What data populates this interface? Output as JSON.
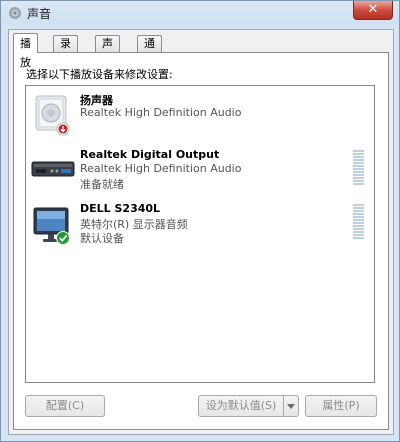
{
  "window": {
    "title": "声音",
    "close_glyph": "✕"
  },
  "tabs": [
    {
      "label": "播放",
      "active": true
    },
    {
      "label": "录制",
      "active": false
    },
    {
      "label": "声音",
      "active": false
    },
    {
      "label": "通信",
      "active": false
    }
  ],
  "panel": {
    "instruction": "选择以下播放设备来修改设置:",
    "devices": [
      {
        "name": "扬声器",
        "description": "Realtek High Definition Audio",
        "status": "",
        "icon": "speaker-icon",
        "badge": "red-down-arrow"
      },
      {
        "name": "Realtek Digital Output",
        "description": "Realtek High Definition Audio",
        "status": "准备就绪",
        "icon": "digital-output-icon",
        "badge": ""
      },
      {
        "name": "DELL S2340L",
        "description": "英特尔(R) 显示器音频",
        "status": "默认设备",
        "icon": "monitor-icon",
        "badge": "green-check"
      }
    ]
  },
  "buttons": {
    "configure": "配置(C)",
    "set_default": "设为默认值(S)",
    "properties": "属性(P)"
  },
  "colors": {
    "accent": "#1f9a2e",
    "disabled_text": "#8a8a8a"
  }
}
